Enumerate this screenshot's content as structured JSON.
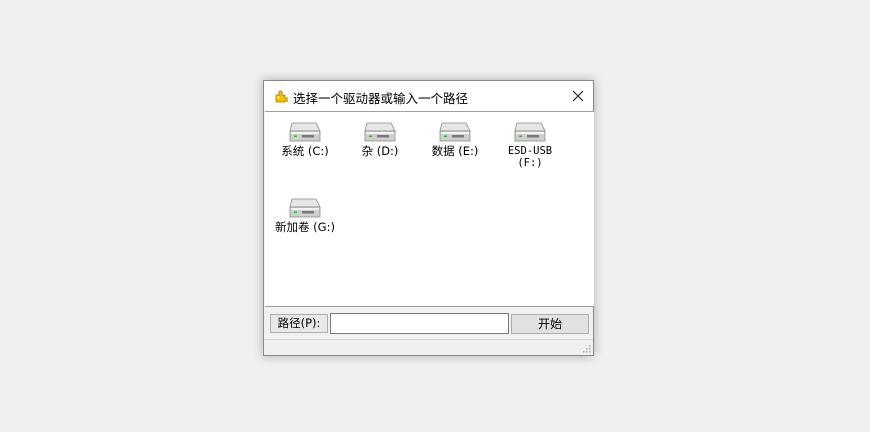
{
  "window": {
    "title": "选择一个驱动器或输入一个路径",
    "app_icon": "puzzle-icon",
    "close_icon": "close-icon"
  },
  "drives": [
    {
      "label": "系统 (C:)",
      "icon": "drive-icon"
    },
    {
      "label": "杂 (D:)",
      "icon": "drive-icon"
    },
    {
      "label": "数据 (E:)",
      "icon": "drive-icon"
    },
    {
      "label": "ESD-USB (F:)",
      "icon": "drive-icon"
    },
    {
      "label": "新加卷 (G:)",
      "icon": "drive-icon"
    }
  ],
  "pathbar": {
    "label": "路径(P):",
    "input_value": "",
    "start_label": "开始"
  },
  "colors": {
    "accent_icon": "#e8b800",
    "panel_bg": "#ffffff",
    "dialog_bg": "#f0f0f0"
  }
}
